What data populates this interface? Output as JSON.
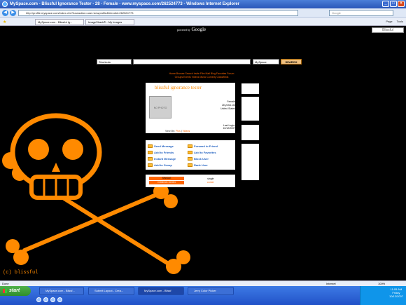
{
  "window": {
    "title": "MySpace.com - Blissful Ignorance Tester - 28 - Female - www.myspace.com/262524773 - Windows Internet Explorer"
  },
  "address": {
    "url": "http://profile.myspace.com/index.cfm?fuseaction=user.viewprofile&friendid=262524773",
    "search_placeholder": "Google"
  },
  "tabs": [
    {
      "label": "MySpace.com - Blissful Ig..."
    },
    {
      "label": "ImageShack® - My Images"
    }
  ],
  "toolbar": {
    "page": "Page",
    "tools": "Tools"
  },
  "corner_box": "Blissful",
  "google": {
    "powered": "powered by",
    "logo": "Google"
  },
  "searchbar": {
    "shortcuts": "Shortcuts",
    "scope": "MySpace",
    "button": "SEARCH"
  },
  "nav": {
    "row1": "Home   Browse   Search   Invite   Film   Mail   Blog   Favorites   Forum",
    "row2": "Groups   Events   Videos   Music   Comedy   Classifieds"
  },
  "profile": {
    "name": "blissful ignorance tester",
    "photo_text": "NO PHOTO",
    "gender": "Female",
    "age": "28 years old",
    "location": "United States",
    "last_login_label": "Last Login:",
    "last_login": "10/12/2007",
    "view_my": "View My:",
    "pics": "Pics",
    "videos": "Videos"
  },
  "contact": {
    "send_message": "Send Message",
    "forward": "Forward to Friend",
    "add_friends": "Add to Friends",
    "add_favorites": "Add to Favorites",
    "instant_message": "Instant Message",
    "block_user": "Block User",
    "add_group": "Add to Group",
    "rank_user": "Rank User"
  },
  "song": {
    "artist": "SINGLE",
    "title": "COMING SOON",
    "label": "single",
    "sub": "comer"
  },
  "copyright": "(c) blissful",
  "status": {
    "text": "Done",
    "zone": "Internet",
    "zoom": "100%"
  },
  "taskbar": {
    "start": "start",
    "items": [
      {
        "label": "MySpace.com - Blissf..."
      },
      {
        "label": "Submit Layout - Crea..."
      },
      {
        "label": "MySpace.com - Blissf"
      },
      {
        "label": "Jerry Color Picker"
      }
    ],
    "time": "11:05 AM",
    "day": "Friday",
    "date": "10/12/2007"
  },
  "colors": {
    "accent": "#ff8a00",
    "link": "#2060c0"
  }
}
